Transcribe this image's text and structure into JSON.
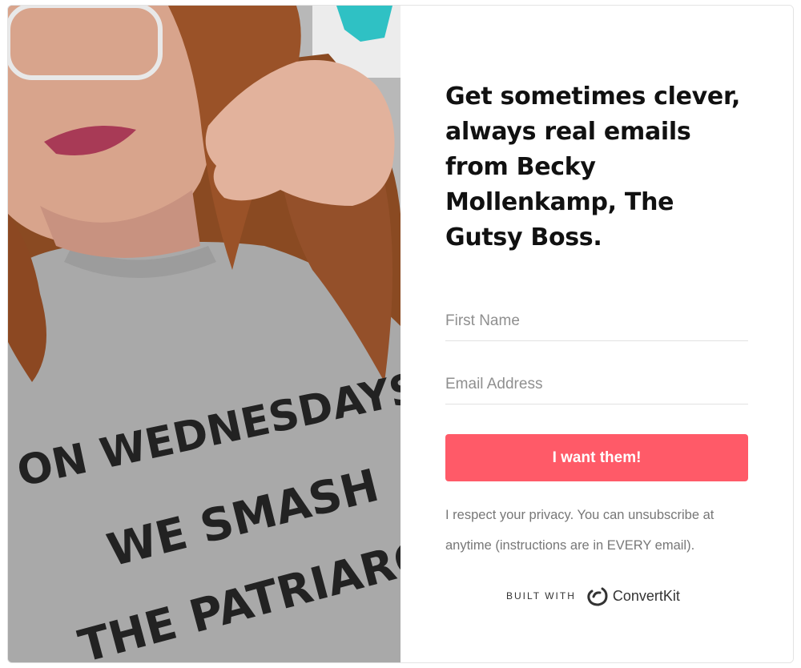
{
  "photo": {
    "alt": "Woman with auburn hair and glasses wearing a gray t-shirt",
    "shirt_text": [
      "ON WEDNESDAYS",
      "WE SMASH",
      "THE PATRIARCHY"
    ]
  },
  "form": {
    "headline": "Get sometimes clever, always real emails from Becky Mollenkamp, The Gutsy Boss.",
    "first_name_placeholder": "First Name",
    "email_placeholder": "Email Address",
    "submit_label": "I want them!",
    "privacy_text": "I respect your privacy. You can unsubscribe at anytime (instructions are in EVERY email).",
    "built_with_label": "BUILT WITH",
    "brand_name": "ConvertKit",
    "brand_icon": "convertkit-logo-icon"
  },
  "colors": {
    "accent": "#ff5a68",
    "headline": "#111111",
    "muted_text": "#777777"
  }
}
